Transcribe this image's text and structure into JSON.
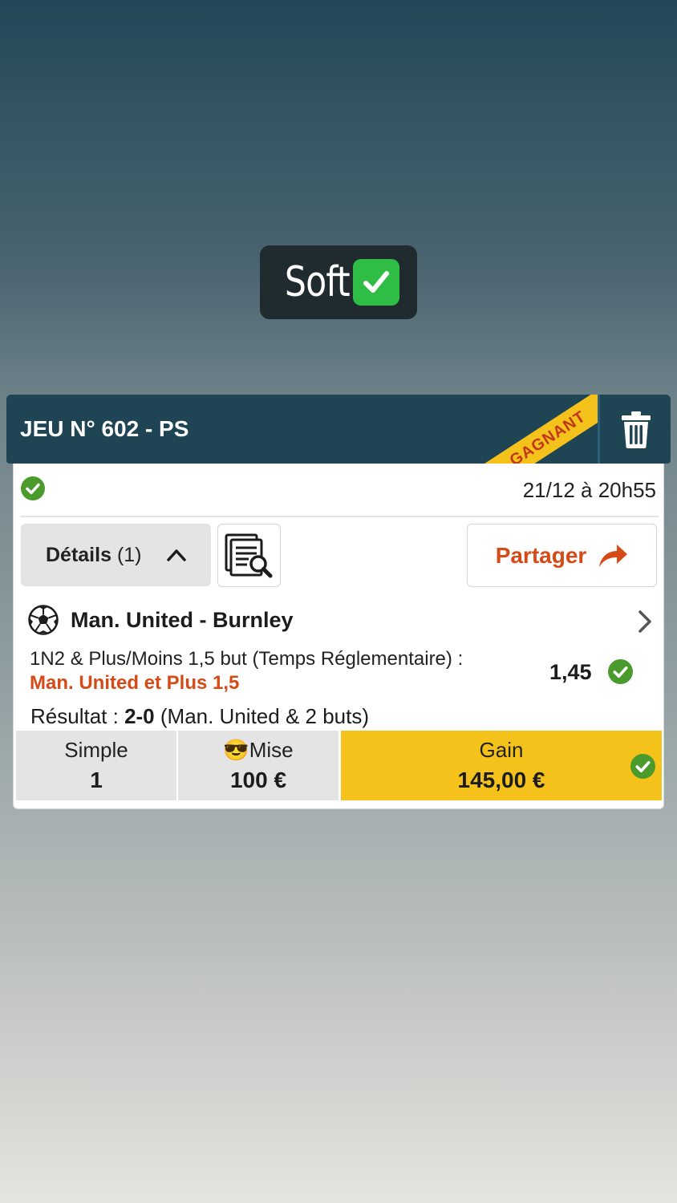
{
  "overlay": {
    "text": "Soft",
    "emoji": "✅"
  },
  "bet": {
    "title": "JEU N° 602 - PS",
    "status": "GAGNANT",
    "date": "21/12 à 20h55",
    "details_label": "Détails",
    "details_count": "(1)",
    "share_label": "Partager",
    "match": "Man. United - Burnley",
    "market": "1N2 & Plus/Moins 1,5 but (Temps Réglementaire) :",
    "selection": "Man. United et Plus 1,5",
    "odds": "1,45",
    "result_label": "Résultat :",
    "result_score": "2-0",
    "result_detail": "(Man. United & 2 buts)",
    "footer": {
      "type_label": "Simple",
      "type_value": "1",
      "stake_label": "😎Mise",
      "stake_value": "100 €",
      "gain_label": "Gain",
      "gain_value": "145,00 €"
    }
  },
  "colors": {
    "header_bg": "#1f4453",
    "accent_orange": "#d54a17",
    "gain_yellow": "#f5c21b",
    "success_green": "#4b9b2c"
  }
}
